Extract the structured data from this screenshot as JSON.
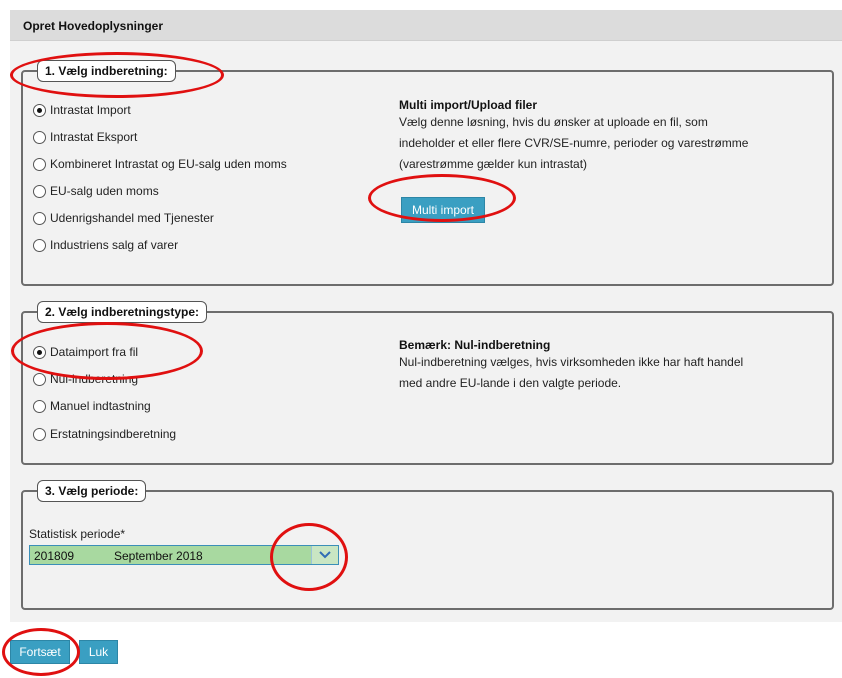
{
  "panel": {
    "title": "Opret Hovedoplysninger"
  },
  "section1": {
    "legend": "1. Vælg indberetning:",
    "options": [
      {
        "label": "Intrastat Import",
        "checked": true
      },
      {
        "label": "Intrastat Eksport",
        "checked": false
      },
      {
        "label": "Kombineret Intrastat og EU-salg uden moms",
        "checked": false
      },
      {
        "label": "EU-salg uden moms",
        "checked": false
      },
      {
        "label": "Udenrigshandel med Tjenester",
        "checked": false
      },
      {
        "label": "Industriens salg af varer",
        "checked": false
      }
    ],
    "info_title": "Multi import/Upload filer",
    "info_lines": [
      "Vælg denne løsning, hvis du ønsker at uploade en fil, som",
      "indeholder et eller flere CVR/SE-numre, perioder og varestrømme",
      "(varestrømme gælder kun intrastat)"
    ],
    "multi_import_label": "Multi import"
  },
  "section2": {
    "legend": "2. Vælg indberetningstype:",
    "options": [
      {
        "label": "Dataimport fra fil",
        "checked": true
      },
      {
        "label": "Nul-indberetning",
        "checked": false
      },
      {
        "label": "Manuel indtastning",
        "checked": false
      },
      {
        "label": "Erstatningsindberetning",
        "checked": false
      }
    ],
    "info_title": "Bemærk: Nul-indberetning",
    "info_lines": [
      "Nul-indberetning vælges, hvis virksomheden ikke har haft handel",
      "med andre EU-lande i den valgte periode."
    ]
  },
  "section3": {
    "legend": "3. Vælg periode:",
    "field_label": "Statistisk periode*",
    "selected_code": "201809",
    "selected_month": "September 2018"
  },
  "footer": {
    "continue_label": "Fortsæt",
    "close_label": "Luk"
  },
  "colors": {
    "button": "#3a9fc2",
    "annotation": "#e01010",
    "select_bg": "#a8d9a0"
  },
  "icons": {
    "dropdown": "chevron-down-icon"
  }
}
